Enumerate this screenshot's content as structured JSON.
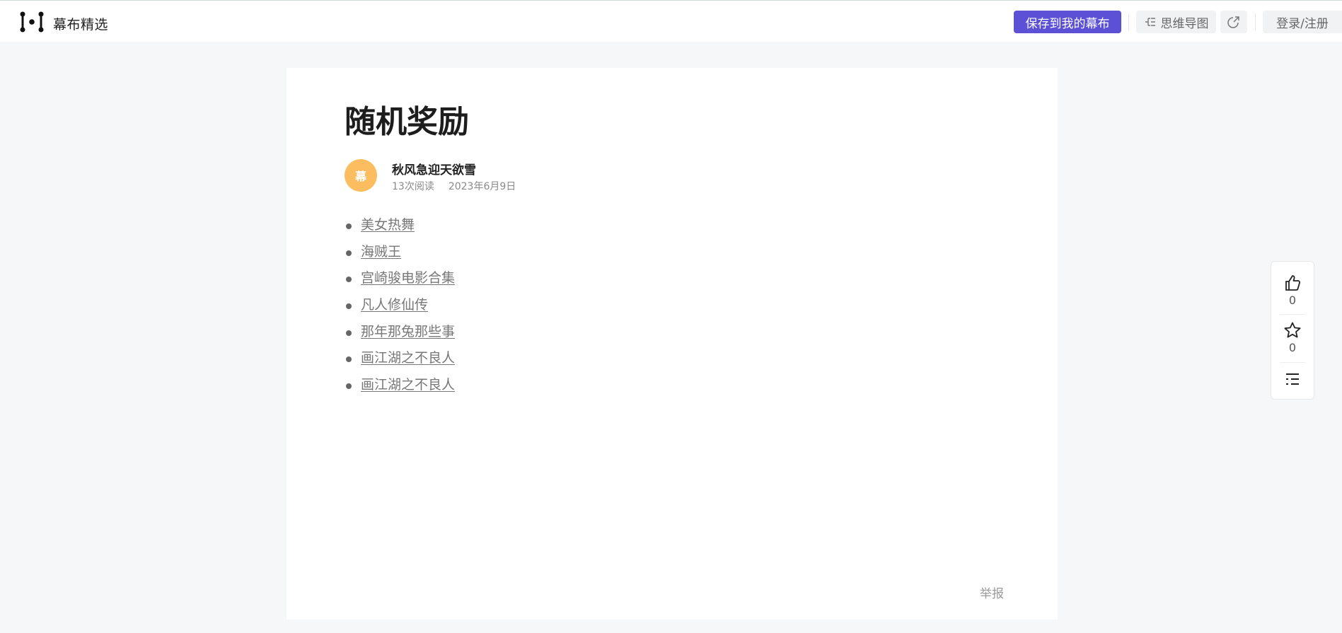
{
  "header": {
    "brand": "幕布精选",
    "save_label": "保存到我的幕布",
    "mindmap_label": "思维导图",
    "login_label": "登录/注册",
    "icons": {
      "logo": "mubu-logo-icon",
      "mindmap": "mindmap-icon",
      "share": "share-icon"
    }
  },
  "article": {
    "title": "随机奖励",
    "author": {
      "name": "秋风急迎天欲雪",
      "avatar_text": "幕",
      "avatar_color": "#fbbd5f"
    },
    "reads": "13次阅读",
    "date": "2023年6月9日",
    "items": [
      "美女热舞",
      "海贼王",
      "宫崎骏电影合集",
      "凡人修仙传",
      "那年那兔那些事",
      "画江湖之不良人",
      "画江湖之不良人"
    ],
    "report_label": "举报"
  },
  "side": {
    "like_count": "0",
    "star_count": "0",
    "icons": [
      "thumbs-up-icon",
      "star-icon",
      "outline-icon"
    ]
  },
  "colors": {
    "primary": "#5b50d6",
    "background": "#f6f7f9"
  }
}
